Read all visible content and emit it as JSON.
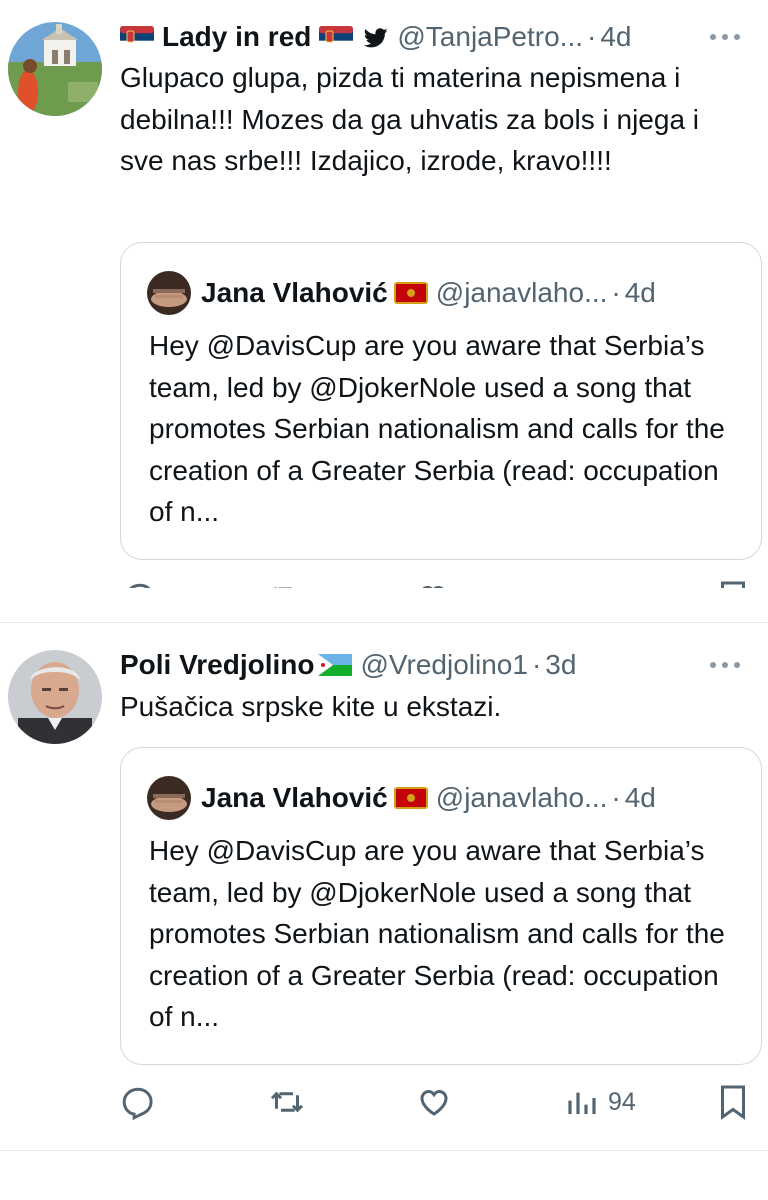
{
  "tweets": [
    {
      "name": "Lady in red",
      "handle": "@TanjaPetro...",
      "separator": "·",
      "time": "4d",
      "text": "Glupaco glupa, pizda ti materina nepismena i debilna!!! Mozes da ga uhvatis za bols i njega i sve nas srbe!!! Izdajico, izrode, kravo!!!!",
      "quote": {
        "name": "Jana Vlahović",
        "handle": "@janavlaho...",
        "separator": "·",
        "time": "4d",
        "text": "Hey @DavisCup are you aware that Serbia’s team, led by @DjokerNole used a song that promotes Serbian nationalism and calls for the creation of a Greater Serbia (read: occupation of n..."
      }
    },
    {
      "name": "Poli Vredjolino",
      "handle": "@Vredjolino1",
      "separator": "·",
      "time": "3d",
      "text": "Pušačica srpske kite u ekstazi.",
      "quote": {
        "name": "Jana Vlahović",
        "handle": "@janavlaho...",
        "separator": "·",
        "time": "4d",
        "text": "Hey @DavisCup are you aware that Serbia’s team, led by @DjokerNole used a song that promotes Serbian nationalism and calls for the creation of a Greater Serbia (read: occupation of n..."
      },
      "actions": {
        "views": "94"
      }
    }
  ],
  "icons": {
    "more": "more-dots-icon",
    "reply": "reply-icon",
    "retweet": "retweet-icon",
    "like": "like-icon",
    "views": "views-icon",
    "bookmark": "bookmark-icon",
    "verified": "twitter-bird-icon"
  },
  "colors": {
    "text": "#0f1419",
    "secondary": "#536471",
    "border": "#cfd9de",
    "divider": "#e3e7ea"
  }
}
